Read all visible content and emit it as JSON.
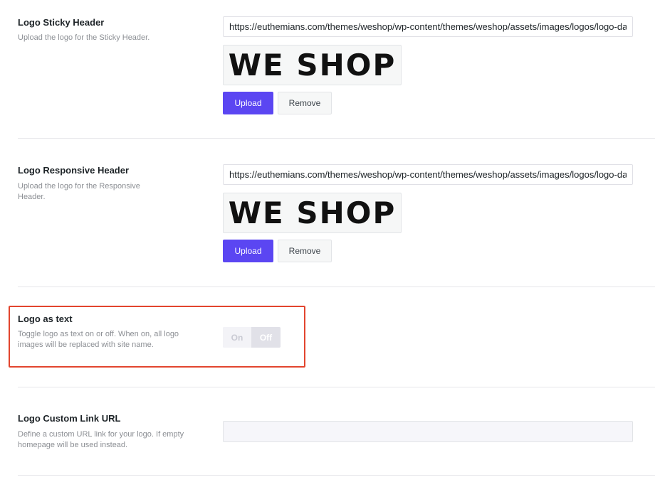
{
  "sticky_header": {
    "title": "Logo Sticky Header",
    "description": "Upload the logo for the Sticky Header.",
    "url": "https://euthemians.com/themes/weshop/wp-content/themes/weshop/assets/images/logos/logo-dark.png",
    "logo_text": "WE SHOP",
    "upload_label": "Upload",
    "remove_label": "Remove"
  },
  "responsive_header": {
    "title": "Logo Responsive Header",
    "description": "Upload the logo for the Responsive Header.",
    "url": "https://euthemians.com/themes/weshop/wp-content/themes/weshop/assets/images/logos/logo-dark.png",
    "logo_text": "WE SHOP",
    "upload_label": "Upload",
    "remove_label": "Remove"
  },
  "logo_as_text": {
    "title": "Logo as text",
    "description": "Toggle logo as text on or off. When on, all logo images will be replaced with site name.",
    "on_label": "On",
    "off_label": "Off",
    "state": "off"
  },
  "custom_link": {
    "title": "Logo Custom Link URL",
    "description": "Define a custom URL link for your logo. If empty homepage will be used instead.",
    "value": "",
    "placeholder": ""
  },
  "colors": {
    "accent": "#5b46f2",
    "highlight": "#e2452e"
  }
}
